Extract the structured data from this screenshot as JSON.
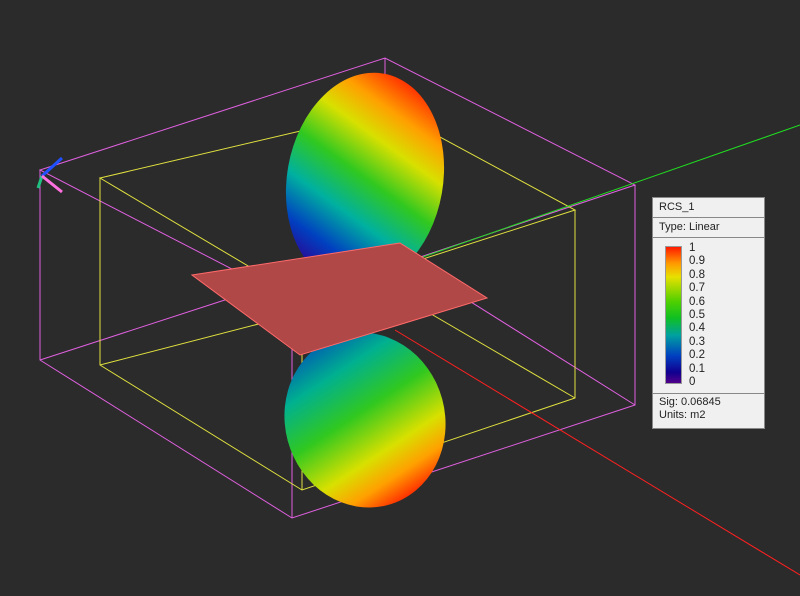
{
  "legend": {
    "title": "RCS_1",
    "type": "Type: Linear",
    "ticks": [
      "1",
      "0.9",
      "0.8",
      "0.7",
      "0.6",
      "0.5",
      "0.4",
      "0.3",
      "0.2",
      "0.1",
      "0"
    ],
    "sig": "Sig: 0.06845",
    "units": "Units: m2"
  },
  "colors": {
    "background": "#2b2b2b",
    "region_box": "#e060e0",
    "bounding_box": "#e0e040",
    "plate": "#b04848",
    "x_axis": "#ff2020",
    "y_axis": "#20e020"
  }
}
